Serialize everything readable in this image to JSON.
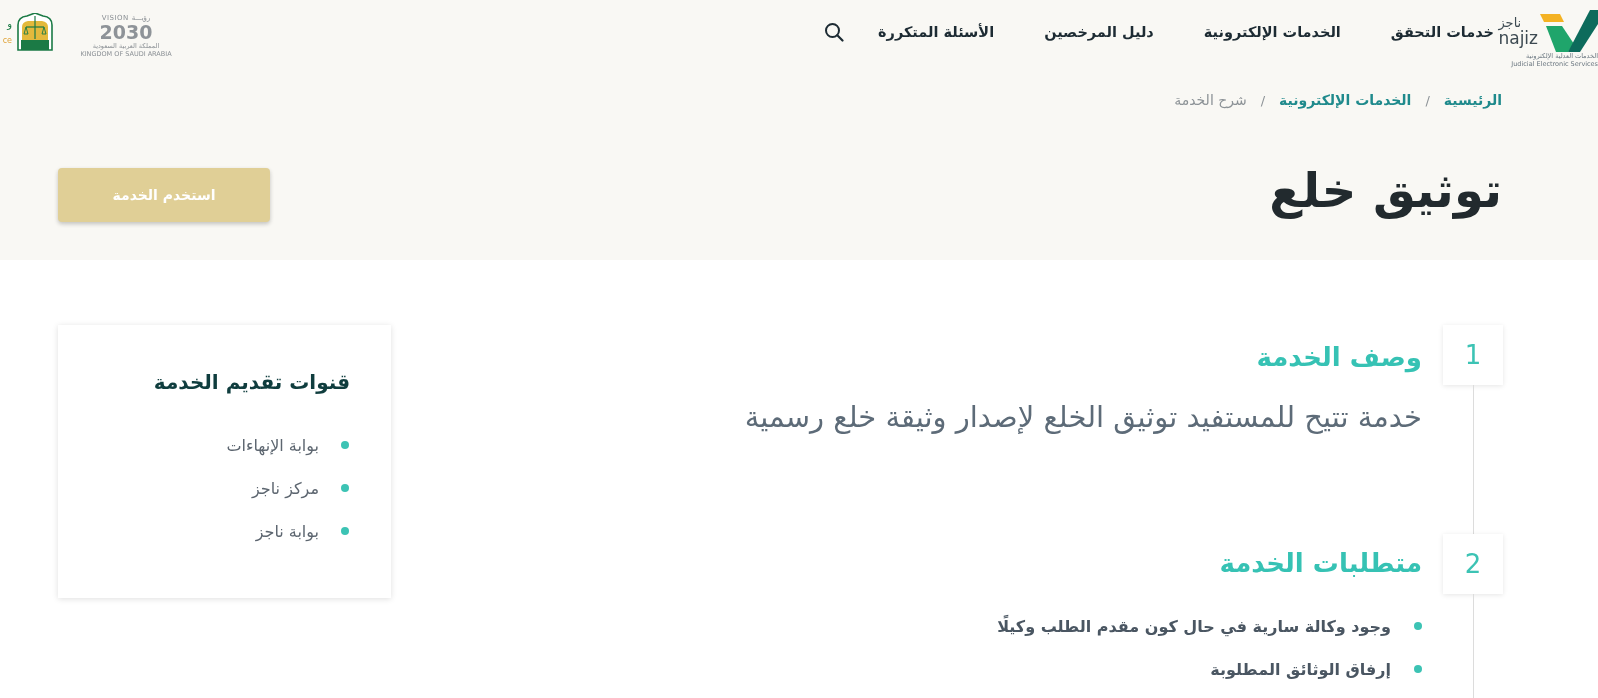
{
  "header": {
    "logo": {
      "arabic": "ناجز",
      "latin": "najiz",
      "subtitle_ar": "الخدمات العدلية الإلكترونية",
      "subtitle_en": "Judicial Electronic Services"
    },
    "nav": [
      "خدمات التحقق",
      "الخدمات الإلكترونية",
      "دليل المرخصين",
      "الأسئلة المتكررة"
    ],
    "vision_logo": {
      "latin": "VISION",
      "arabic": "رؤيـــة",
      "year": "2030",
      "tagline_ar": "المملكة العربية السعودية",
      "tagline_en": "KINGDOM OF SAUDI ARABIA"
    },
    "partial_logo": {
      "arabic": "و",
      "latin": "ce"
    }
  },
  "breadcrumb": {
    "items": [
      {
        "label": "الرئيسية",
        "kind": "link"
      },
      {
        "label": "الخدمات الإلكترونية",
        "kind": "link"
      },
      {
        "label": "شرح الخدمة",
        "kind": "current"
      }
    ],
    "separators": [
      "/",
      "/"
    ]
  },
  "page_title": "توثيق خلع",
  "action_button": "استخدم الخدمة",
  "steps": [
    {
      "number": "1",
      "title": "وصف الخدمة",
      "kind": "text",
      "text": "خدمة تتيح للمستفيد توثيق الخلع لإصدار وثيقة خلع رسمية"
    },
    {
      "number": "2",
      "title": "متطلبات الخدمة",
      "kind": "list",
      "items": [
        "وجود وكالة سارية في حال كون مقدم الطلب وكيلًا",
        "إرفاق الوثائق المطلوبة"
      ]
    }
  ],
  "channels_card": {
    "title": "قنوات تقديم الخدمة",
    "items": [
      "بوابة الإنهاءات",
      "مركز ناجز",
      "بوابة ناجز"
    ]
  }
}
